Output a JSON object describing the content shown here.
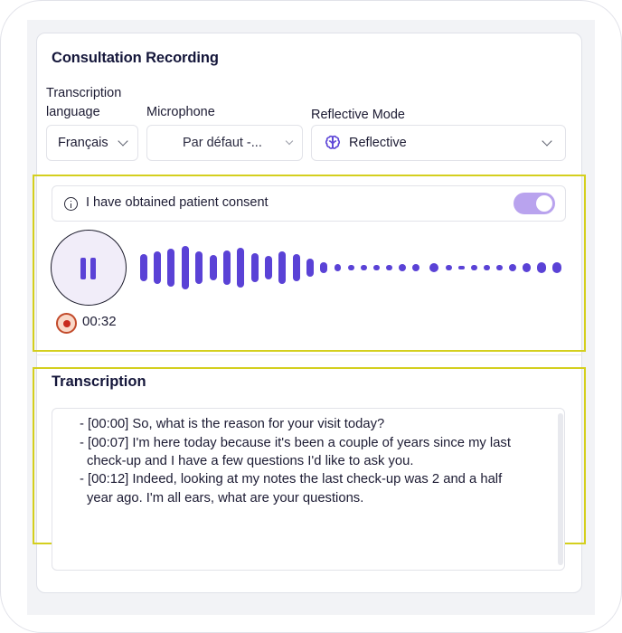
{
  "title": "Consultation Recording",
  "labels": {
    "transcription_language_1": "Transcription",
    "transcription_language_2": "language",
    "microphone": "Microphone",
    "reflective_mode": "Reflective Mode"
  },
  "selects": {
    "language_value": "Français",
    "microphone_value": "Par défaut -...",
    "mode_value": "Reflective"
  },
  "consent": {
    "text": "I have obtained patient consent",
    "enabled": true
  },
  "recording": {
    "elapsed": "00:32",
    "state": "recording"
  },
  "transcription": {
    "title": "Transcription",
    "lines": [
      "- [00:00] So, what is the reason for your visit today?",
      "- [00:07] I'm here today because it's been a couple of years since my last",
      "check-up and I have a few questions I'd like to ask you.",
      "- [00:12] Indeed, looking at my notes the last check-up was 2 and a half",
      "year ago. I'm all ears, what are your questions."
    ]
  },
  "colors": {
    "accent": "#5a42d6",
    "toggle": "#b9a3ee",
    "highlight": "#d4cf1e",
    "record": "#c82a1e"
  }
}
